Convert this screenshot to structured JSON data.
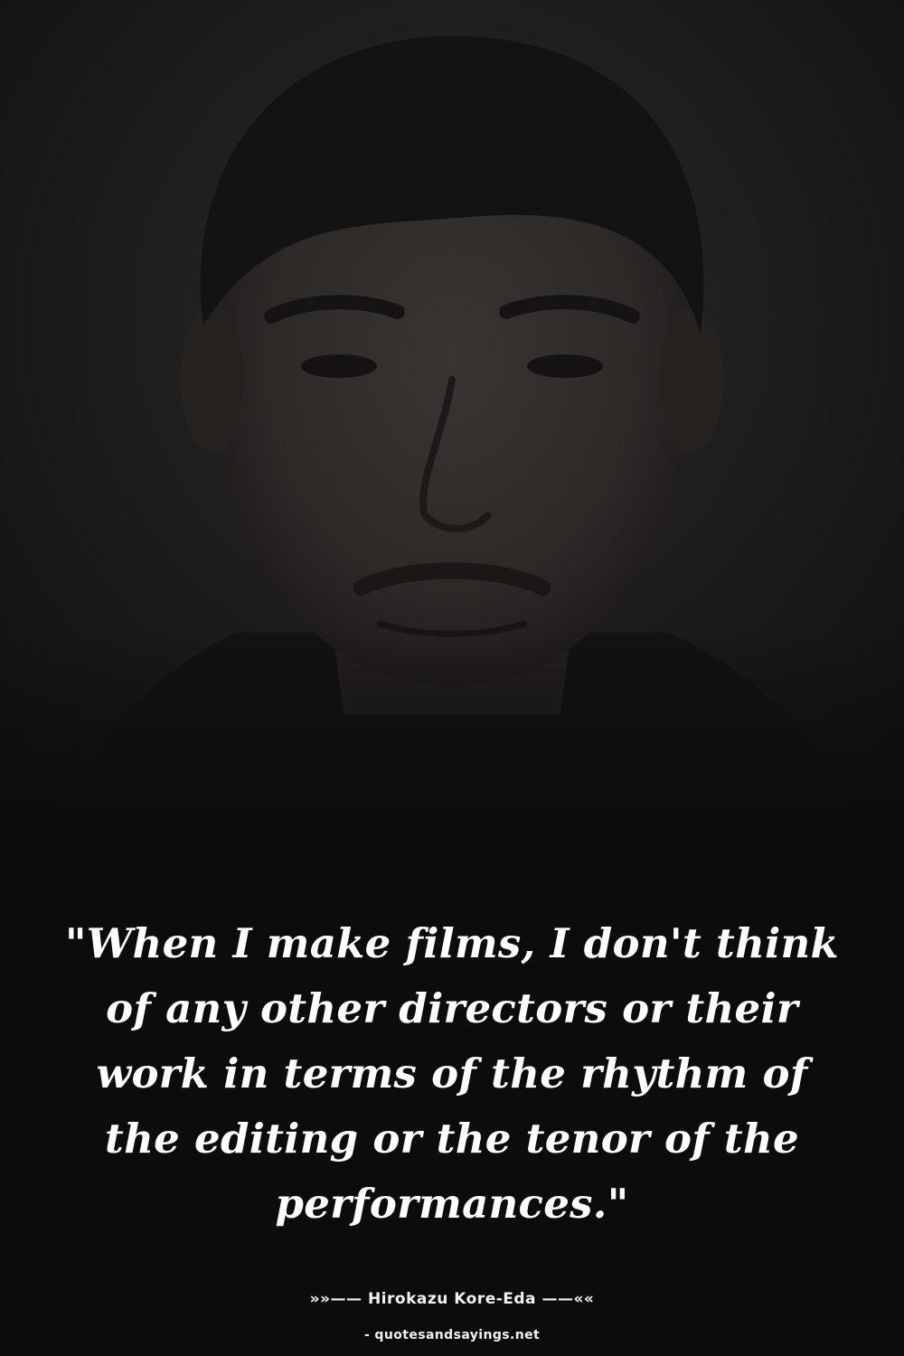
{
  "background_photo": {
    "subject": "portrait-photo",
    "tone": "dark"
  },
  "quote": {
    "text": "\"When I make films, I don't think of any other directors or their work in terms of the rhythm of the editing or the tenor of the performances.\""
  },
  "attribution": {
    "text": "»»—— Hirokazu Kore-Eda ——««"
  },
  "source": {
    "text": "- quotesandsayings.net"
  },
  "colors": {
    "text": "#ffffff",
    "background": "#0c0c0c"
  }
}
